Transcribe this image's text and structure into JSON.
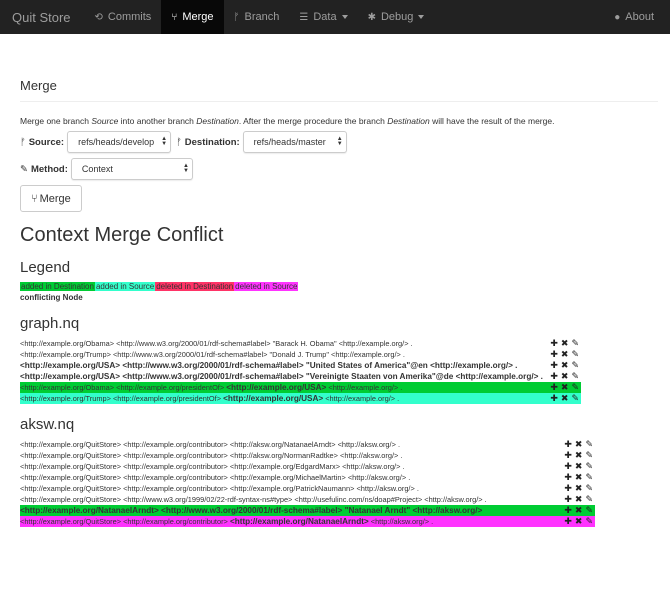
{
  "nav": {
    "brand": "Quit Store",
    "commits": "Commits",
    "merge": "Merge",
    "branch": "Branch",
    "data": "Data",
    "debug": "Debug",
    "about": "About"
  },
  "page": {
    "title": "Merge",
    "intro_a": "Merge one branch ",
    "intro_source": "Source",
    "intro_b": " into another branch ",
    "intro_destination": "Destination",
    "intro_c": ". After the merge procedure the branch ",
    "intro_destination2": "Destination",
    "intro_d": " will have the result of the merge."
  },
  "form": {
    "source_label": "Source:",
    "source_value": "refs/heads/develop",
    "destination_label": "Destination:",
    "destination_value": "refs/heads/master",
    "method_label": "Method:",
    "method_value": "Context",
    "merge_button": "Merge"
  },
  "conflict": {
    "title": "Context Merge Conflict",
    "legend_title": "Legend",
    "legend": {
      "added_dest": "added in Destination",
      "added_src": "added in Source",
      "deleted_dest": "deleted in Destination",
      "deleted_src": "deleted in Source",
      "conflicting": "conflicting Node"
    },
    "colors": {
      "added_dest": "#00cc33",
      "added_src": "#33ffcc",
      "deleted_dest": "#ff3366",
      "deleted_src": "#ff33ff"
    }
  },
  "graphs": [
    {
      "name": "graph.nq",
      "rows": [
        {
          "pre": "<http://example.org/Obama> <http://www.w3.org/2000/01/rdf-schema#label> \"Barack H. Obama\" <http://example.org/> .",
          "bold": "",
          "post": "",
          "style": ""
        },
        {
          "pre": "<http://example.org/Trump> <http://www.w3.org/2000/01/rdf-schema#label> \"Donald J. Trump\" <http://example.org/> .",
          "bold": "",
          "post": "",
          "style": ""
        },
        {
          "pre": "",
          "bold": "<http://example.org/USA>",
          "post": " <http://www.w3.org/2000/01/rdf-schema#label> \"United States of America\"@en <http://example.org/> .",
          "style": ""
        },
        {
          "pre": "",
          "bold": "<http://example.org/USA>",
          "post": " <http://www.w3.org/2000/01/rdf-schema#label> \"Vereinigte Staaten von Amerika\"@de <http://example.org/> .",
          "style": ""
        },
        {
          "pre": "<http://example.org/Obama> <http://example.org/presidentOf> ",
          "bold": "<http://example.org/USA>",
          "post": " <http://example.org/> .",
          "style": "hl-dd"
        },
        {
          "pre": "<http://example.org/Trump> <http://example.org/presidentOf> ",
          "bold": "<http://example.org/USA>",
          "post": " <http://example.org/> .",
          "style": "hl-as"
        }
      ]
    },
    {
      "name": "aksw.nq",
      "rows": [
        {
          "pre": "<http://example.org/QuitStore> <http://example.org/contributor> <http://aksw.org/NatanaelArndt> <http://aksw.org/> .",
          "bold": "",
          "post": "",
          "style": ""
        },
        {
          "pre": "<http://example.org/QuitStore> <http://example.org/contributor> <http://aksw.org/NormanRadtke> <http://aksw.org/> .",
          "bold": "",
          "post": "",
          "style": ""
        },
        {
          "pre": "<http://example.org/QuitStore> <http://example.org/contributor> <http://example.org/EdgardMarx> <http://aksw.org/> .",
          "bold": "",
          "post": "",
          "style": ""
        },
        {
          "pre": "<http://example.org/QuitStore> <http://example.org/contributor> <http://example.org/MichaelMartin> <http://aksw.org/> .",
          "bold": "",
          "post": "",
          "style": ""
        },
        {
          "pre": "<http://example.org/QuitStore> <http://example.org/contributor> <http://example.org/PatrickNaumann> <http://aksw.org/> .",
          "bold": "",
          "post": "",
          "style": ""
        },
        {
          "pre": "<http://example.org/QuitStore> <http://www.w3.org/1999/02/22-rdf-syntax-ns#type> <http://usefulinc.com/ns/doap#Project> <http://aksw.org/> .",
          "bold": "",
          "post": "",
          "style": ""
        },
        {
          "pre": "",
          "bold": "<http://example.org/NatanaelArndt>",
          "post": " <http://www.w3.org/2000/01/rdf-schema#label> \"Natanael Arndt\" <http://aksw.org/>",
          "style": "hl-dd"
        },
        {
          "pre": "<http://example.org/QuitStore> <http://example.org/contributor> ",
          "bold": "<http://example.org/NatanaelArndt>",
          "post": " <http://aksw.org/> .",
          "style": "hl-dsrc"
        }
      ]
    }
  ]
}
